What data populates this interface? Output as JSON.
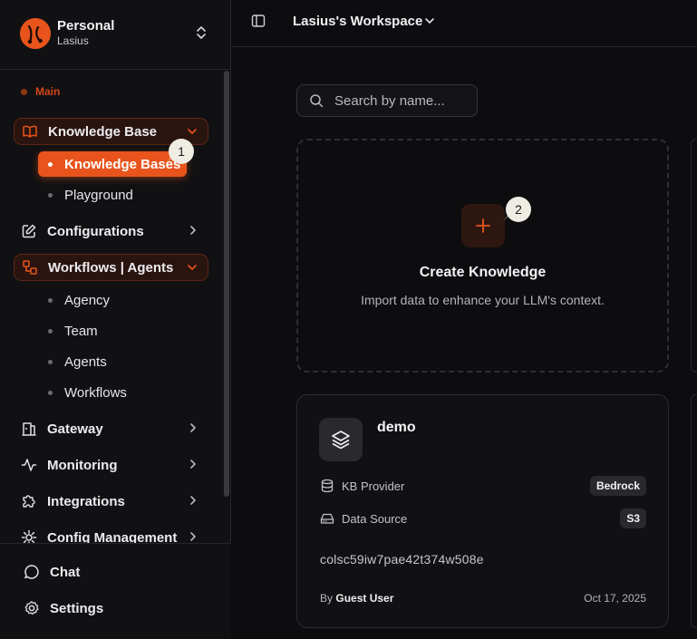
{
  "org": {
    "name": "Personal",
    "user": "Lasius"
  },
  "sidebar": {
    "section_label": "Main",
    "items": [
      {
        "label": "Knowledge Base",
        "icon": "book-icon",
        "expanded": true,
        "children": [
          {
            "label": "Knowledge Bases",
            "active": true
          },
          {
            "label": "Playground"
          }
        ]
      },
      {
        "label": "Configurations",
        "icon": "edit-icon"
      },
      {
        "label": "Workflows | Agents",
        "icon": "workflow-icon",
        "expanded": true,
        "children": [
          {
            "label": "Agency"
          },
          {
            "label": "Team"
          },
          {
            "label": "Agents"
          },
          {
            "label": "Workflows"
          }
        ]
      },
      {
        "label": "Gateway",
        "icon": "gateway-icon"
      },
      {
        "label": "Monitoring",
        "icon": "activity-icon"
      },
      {
        "label": "Integrations",
        "icon": "puzzle-icon"
      },
      {
        "label": "Config Management",
        "icon": "cog-icon"
      }
    ],
    "bottom": [
      {
        "label": "Chat",
        "icon": "chat-icon"
      },
      {
        "label": "Settings",
        "icon": "settings-icon"
      }
    ]
  },
  "tour_badges": [
    "1",
    "2"
  ],
  "header": {
    "workspace_title": "Lasius's Workspace"
  },
  "search": {
    "placeholder": "Search by name..."
  },
  "create_card": {
    "title": "Create Knowledge",
    "subtitle": "Import data to enhance your LLM's context."
  },
  "kb_card": {
    "name": "demo",
    "provider_label": "KB Provider",
    "provider_value": "Bedrock",
    "source_label": "Data Source",
    "source_value": "S3",
    "id": "colsc59iw7pae42t374w508e",
    "by_prefix": "By",
    "author": "Guest User",
    "date": "Oct 17, 2025"
  },
  "colors": {
    "accent": "#e8541c",
    "background": "#0d0d0f",
    "sidebar": "#111113"
  }
}
